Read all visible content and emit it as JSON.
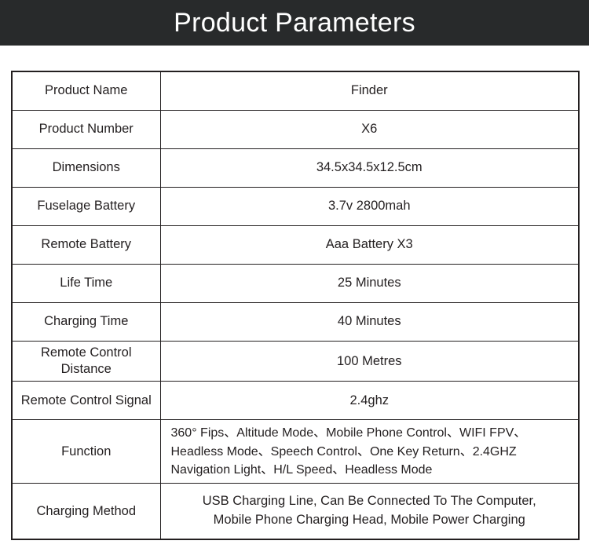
{
  "header": {
    "title": "Product Parameters",
    "background_color": "#282a2b",
    "text_color": "#ffffff"
  },
  "table": {
    "border_color": "#231f20",
    "text_color": "#231f20",
    "background_color": "#ffffff",
    "rows": [
      {
        "label": "Product Name",
        "value": "Finder"
      },
      {
        "label": "Product Number",
        "value": "X6"
      },
      {
        "label": "Dimensions",
        "value": "34.5x34.5x12.5cm"
      },
      {
        "label": "Fuselage Battery",
        "value": "3.7v 2800mah"
      },
      {
        "label": "Remote Battery",
        "value": "Aaa Battery X3"
      },
      {
        "label": "Life Time",
        "value": "25 Minutes"
      },
      {
        "label": "Charging Time",
        "value": "40 Minutes"
      },
      {
        "label": "Remote Control Distance",
        "value": "100 Metres"
      },
      {
        "label": "Remote Control Signal",
        "value": "2.4ghz"
      }
    ],
    "function_row": {
      "label": "Function",
      "lines": [
        "360° Fips、Altitude Mode、Mobile Phone Control、WIFI FPV、",
        "Headless Mode、Speech Control、One Key Return、2.4GHZ",
        "Navigation Light、H/L Speed、Headless Mode"
      ]
    },
    "charging_row": {
      "label": "Charging Method",
      "lines": [
        "USB Charging Line, Can Be Connected To The Computer,",
        "Mobile Phone Charging Head, Mobile Power Charging"
      ]
    }
  }
}
